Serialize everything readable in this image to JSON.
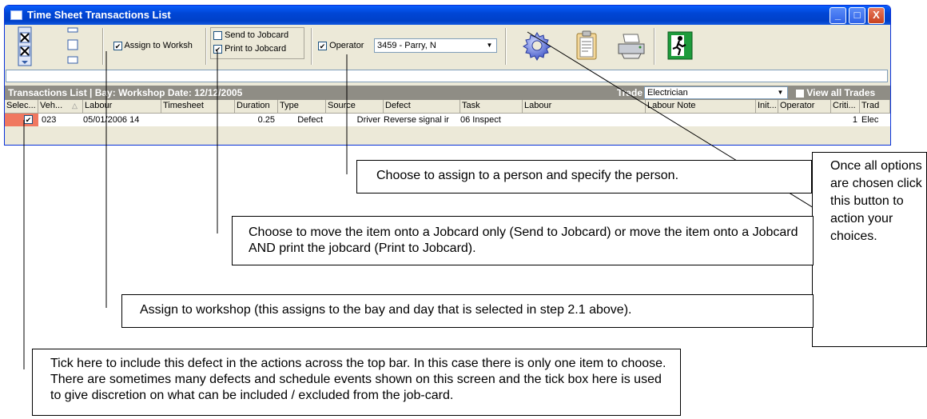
{
  "window": {
    "title": "Time Sheet Transactions List",
    "buttons": {
      "minimize": "_",
      "maximize": "□",
      "close": "X"
    }
  },
  "toolbar": {
    "assign_workshop_label": "Assign to Worksh",
    "assign_workshop_checked": true,
    "send_jobcard_label": "Send to Jobcard",
    "send_jobcard_checked": false,
    "print_jobcard_label": "Print to Jobcard",
    "print_jobcard_checked": true,
    "operator_label": "Operator",
    "operator_checked": true,
    "operator_value": "3459 - Parry, N",
    "icons": [
      "select-all-icon",
      "deselect-icon",
      "gear-icon",
      "clipboard-icon",
      "printer-icon",
      "exit-icon"
    ]
  },
  "caption": {
    "text": "Transactions List | Bay: Workshop  Date: 12/12/2005",
    "trade_label": "Trade",
    "trade_value": "Electrician",
    "view_all_label": "View all Trades"
  },
  "columns": [
    "Selec...",
    "Veh...",
    "Labour",
    "Timesheet",
    "Duration",
    "Type",
    "Source",
    "Defect",
    "Task",
    "Labour",
    "Labour Note",
    "Init...",
    "Operator",
    "Criti...",
    "Trad"
  ],
  "rows": [
    {
      "selected": true,
      "vehicle": "023",
      "labour": "05/01/2006 14",
      "timesheet": "",
      "duration": "0.25",
      "type": "Defect",
      "source": "Driver",
      "defect": "Reverse signal ir",
      "task": "06 Inspect",
      "criticality": "1",
      "trade": "Elec"
    }
  ],
  "callouts": {
    "operator": "Choose to assign to a person and specify the person.",
    "action": "Once all options are chosen click this button to action your choices.",
    "jobcard": "Choose to move the item onto a Jobcard only (Send to Jobcard) or move the item onto a Jobcard AND print the jobcard (Print to Jobcard).",
    "workshop": "Assign to workshop (this assigns to the bay and day that is selected in step 2.1 above).",
    "tick": "Tick here to include this defect in the actions across the top bar.  In this case there is only one item to choose.  There are sometimes many defects and schedule events shown on this screen and the tick box here is used to give discretion on what can be included / excluded from the job-card."
  },
  "colors": {
    "titlebar": "#0046d5",
    "window_bg": "#ece9d8",
    "selected_cell": "#f07860",
    "caption_bg": "#8f8d85"
  }
}
